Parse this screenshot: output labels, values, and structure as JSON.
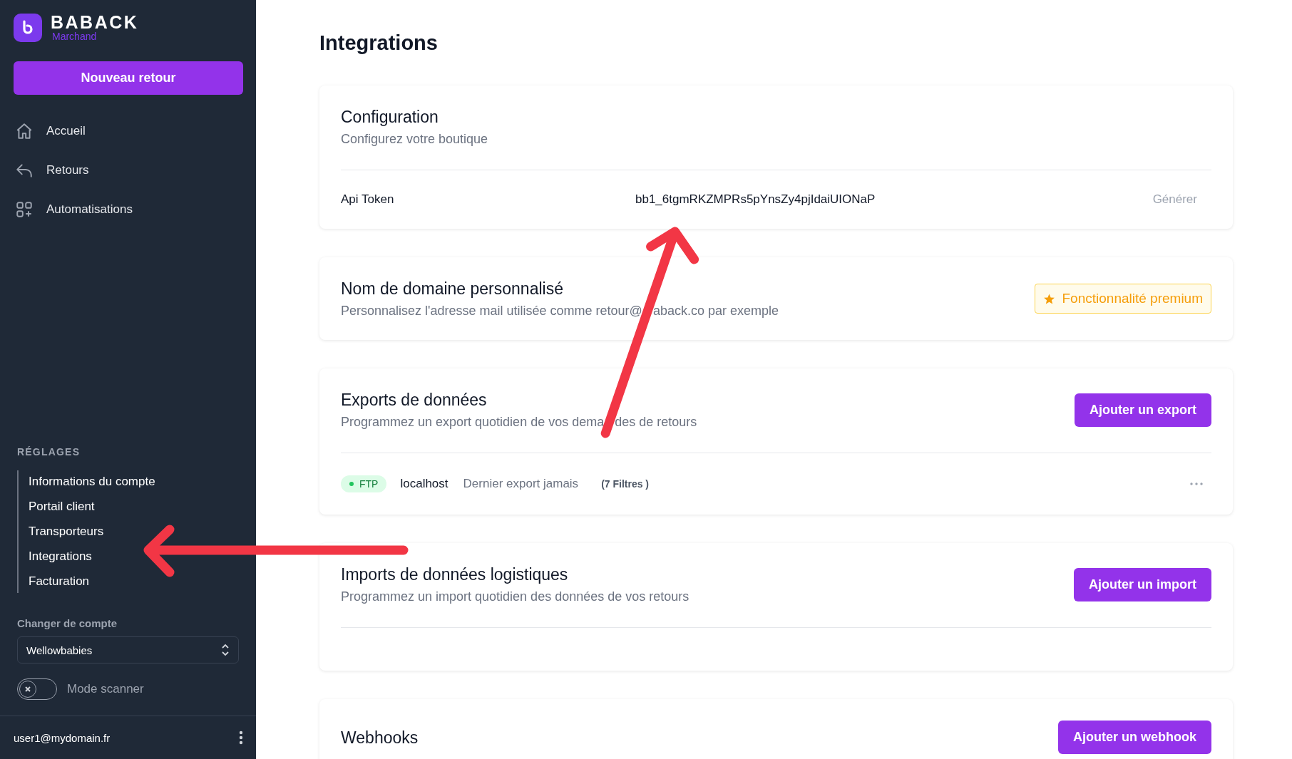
{
  "sidebar": {
    "brand": "BABACK",
    "brand_subtitle": "Marchand",
    "new_button": "Nouveau retour",
    "nav": [
      "Accueil",
      "Retours",
      "Automatisations"
    ],
    "settings_heading": "RÉGLAGES",
    "settings_items": [
      "Informations du compte",
      "Portail client",
      "Transporteurs",
      "Integrations",
      "Facturation"
    ],
    "account_label": "Changer de compte",
    "account_select": "Wellowbabies",
    "scanner_toggle": {
      "label": "Mode scanner",
      "on": false
    },
    "user_email": "user1@mydomain.fr"
  },
  "page_title": "Integrations",
  "cards": [
    {
      "kind": "token",
      "title": "Configuration",
      "subtitle": "Configurez votre boutique",
      "token_label": "Api Token",
      "token_value": "bb1_6tgmRKZMPRs5pYnsZy4pjIdaiUIONaP",
      "action": "Générer"
    },
    {
      "kind": "premium",
      "title": "Nom de domaine personnalisé",
      "subtitle_parts": [
        "Personnalisez l'adresse mail utilisée comme retour@",
        "aback.co par exemple"
      ],
      "badge": "Fonctionnalité premium"
    },
    {
      "kind": "list",
      "title": "Exports de données",
      "subtitle_parts": [
        "Programmez un export quotidien de vos dema",
        "des de retours"
      ],
      "button": "Ajouter un export",
      "rows": [
        {
          "tag": "FTP",
          "host": "localhost",
          "last": "Dernier export jamais",
          "filters": "(7 Filtres )"
        }
      ]
    },
    {
      "kind": "list",
      "title": "Imports de données logistiques",
      "subtitle": "Programmez un import quotidien des données de vos retours",
      "button": "Ajouter un import"
    },
    {
      "kind": "action",
      "title": "Webhooks",
      "button": "Ajouter un webhook"
    }
  ]
}
